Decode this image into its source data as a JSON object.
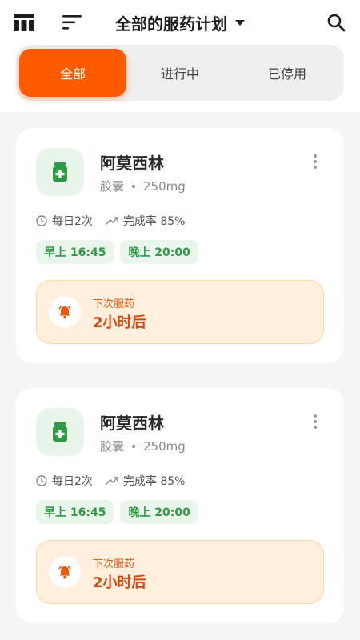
{
  "header": {
    "title": "全部的服药计划",
    "icons": [
      "table-icon",
      "sort-icon",
      "chevron-down-icon",
      "search-icon"
    ]
  },
  "tabs": [
    {
      "label": "全部",
      "active": true
    },
    {
      "label": "进行中",
      "active": false
    },
    {
      "label": "已停用",
      "active": false
    }
  ],
  "plans": [
    {
      "name": "阿莫西林",
      "form": "胶囊",
      "dose": "250mg",
      "frequency": "每日2次",
      "completion": "完成率 85%",
      "times": [
        "早上 16:45",
        "晚上 20:00"
      ],
      "next_label": "下次服药",
      "next_value": "2小时后"
    },
    {
      "name": "阿莫西林",
      "form": "胶囊",
      "dose": "250mg",
      "frequency": "每日2次",
      "completion": "完成率 85%",
      "times": [
        "早上 16:45",
        "晚上 20:00"
      ],
      "next_label": "下次服药",
      "next_value": "2小时后"
    }
  ],
  "colors": {
    "accent": "#ff5a00",
    "green": "#2e9a44",
    "green_bg": "#eaf6ec",
    "next_bg": "#ffefdc",
    "next_text": "#d9480f"
  }
}
